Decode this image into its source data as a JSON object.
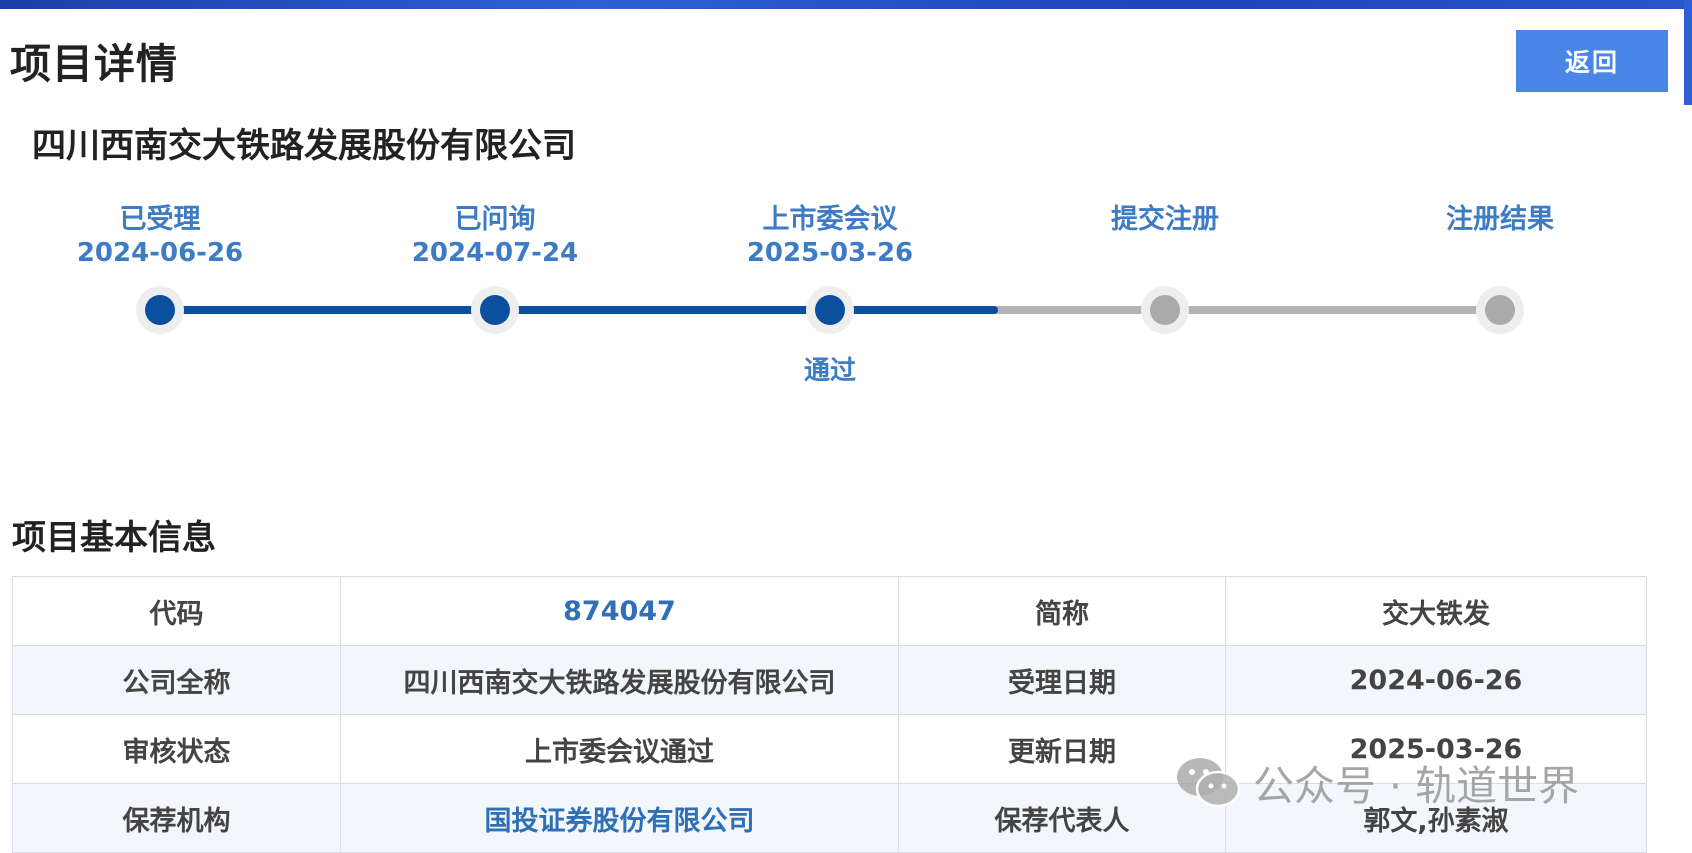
{
  "header": {
    "page_title": "项目详情",
    "back_label": "返回"
  },
  "company": {
    "name": "四川西南交大铁路发展股份有限公司"
  },
  "progress": {
    "steps": [
      {
        "name": "已受理",
        "date": "2024-06-26",
        "status": "done"
      },
      {
        "name": "已问询",
        "date": "2024-07-24",
        "status": "done"
      },
      {
        "name": "上市委会议",
        "date": "2025-03-26",
        "result": "通过",
        "status": "done"
      },
      {
        "name": "提交注册",
        "status": "pending"
      },
      {
        "name": "注册结果",
        "status": "pending"
      }
    ],
    "colors": {
      "done": "#0c4f9e",
      "pending": "#aaaaaa",
      "label": "#3d7cc4"
    }
  },
  "basic_info": {
    "title": "项目基本信息",
    "rows": [
      {
        "label1": "代码",
        "value1": "874047",
        "label2": "简称",
        "value2": "交大铁发"
      },
      {
        "label1": "公司全称",
        "value1": "四川西南交大铁路发展股份有限公司",
        "label2": "受理日期",
        "value2": "2024-06-26"
      },
      {
        "label1": "审核状态",
        "value1": "上市委会议通过",
        "label2": "更新日期",
        "value2": "2025-03-26"
      },
      {
        "label1": "保荐机构",
        "value1": "国投证券股份有限公司",
        "label2": "保荐代表人",
        "value2": "郭文,孙素淑"
      }
    ]
  },
  "watermark": {
    "icon": "wechat-icon",
    "text": "公众号 · 轨道世界"
  }
}
